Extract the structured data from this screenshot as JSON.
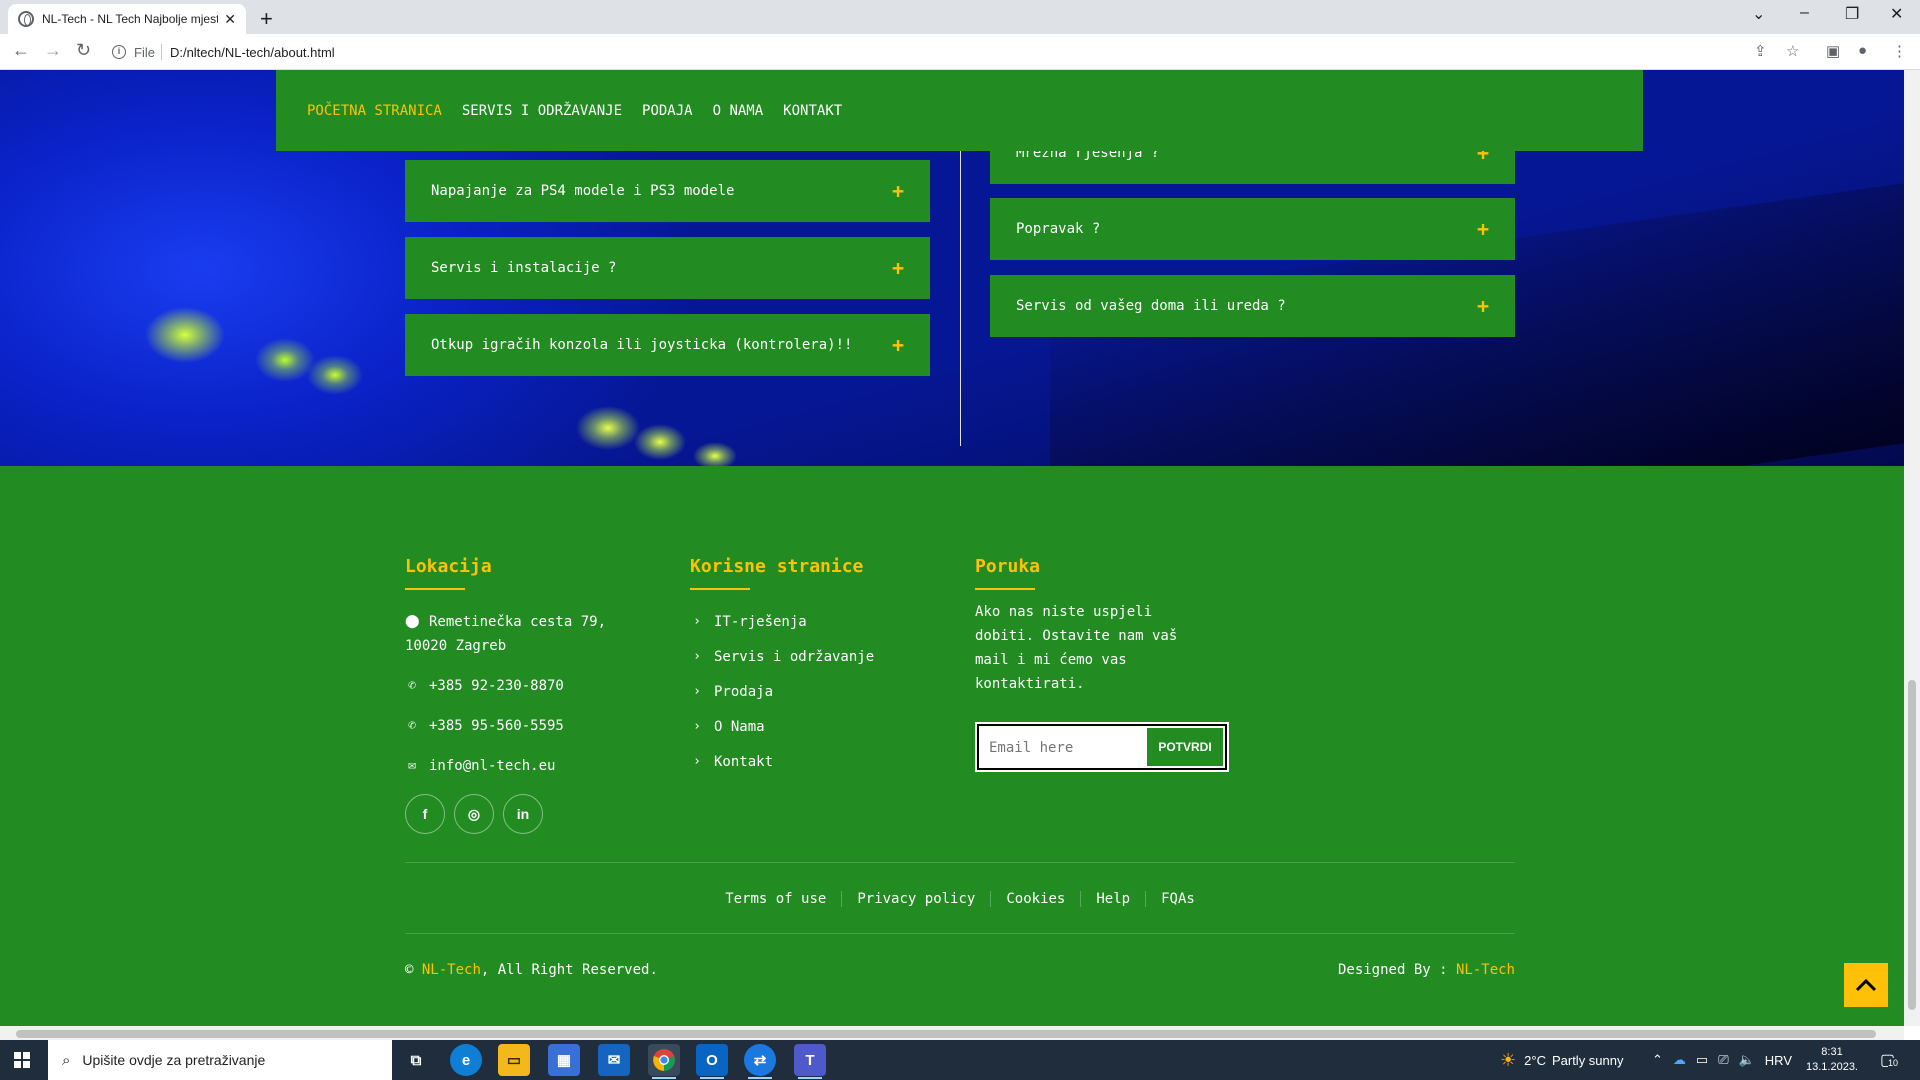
{
  "browser": {
    "tab_title": "NL-Tech - NL Tech Najbolje mjest",
    "url_scheme": "File",
    "url": "D:/nltech/NL-tech/about.html"
  },
  "nav": {
    "items": [
      "POČETNA STRANICA",
      "SERVIS I ODRŽAVANJE",
      "PODAJA",
      "O NAMA",
      "KONTAKT"
    ]
  },
  "accordion_left": [
    "Napajanje za PS4 modele i PS3 modele",
    "Servis i instalacije ?",
    "Otkup igračih konzola ili joysticka (kontrolera)!!"
  ],
  "accordion_right": [
    "Mrežna rješenja ?",
    "Popravak ?",
    "Servis od vašeg doma ili ureda ?"
  ],
  "footer": {
    "location_title": "Lokacija",
    "address_line1": "Remetinečka cesta 79,",
    "address_line2": "10020 Zagreb",
    "phone1": "+385 92-230-8870",
    "phone2": "+385 95-560-5595",
    "email": "info@nl-tech.eu",
    "links_title": "Korisne stranice",
    "links": [
      "IT-rješenja",
      "Servis i održavanje",
      "Prodaja",
      "O Nama",
      "Kontakt"
    ],
    "message_title": "Poruka",
    "message_text": "Ako nas niste uspjeli dobiti. Ostavite nam vaš mail i mi ćemo vas kontaktirati.",
    "email_placeholder": "Email here",
    "submit_label": "POTVRDI",
    "bottom_links": [
      "Terms of use",
      "Privacy policy",
      "Cookies",
      "Help",
      "FQAs"
    ],
    "copyright_prefix": "©",
    "brand": "NL-Tech",
    "copyright_suffix": ", All Right Reserved.",
    "designed_by": "Designed By :",
    "designed_brand": "NL-Tech"
  },
  "taskbar": {
    "search_placeholder": "Upišite ovdje za pretraživanje",
    "weather_temp": "2°C",
    "weather_text": "Partly sunny",
    "language": "HRV",
    "time": "8:31",
    "date": "13.1.2023.",
    "notifications": "10"
  },
  "colors": {
    "brand_green": "#228b22",
    "accent_yellow": "#ffc107"
  }
}
